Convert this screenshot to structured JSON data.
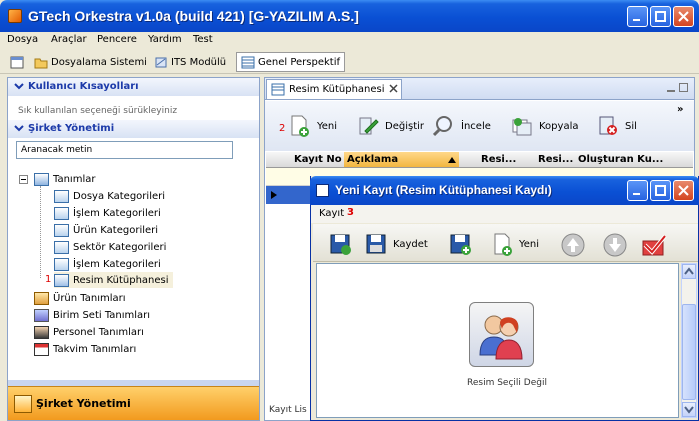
{
  "window": {
    "title": "GTech Orkestra v1.0a (build 421) [G-YAZILIM A.S.]"
  },
  "menu": [
    "Dosya",
    "Araçlar",
    "Pencere",
    "Yardım",
    "Test"
  ],
  "perspectives": [
    {
      "label": "Dosyalama Sistemi",
      "icon": "folder-icon"
    },
    {
      "label": "ITS Modülü",
      "icon": "satellite-icon"
    },
    {
      "label": "Genel Perspektif",
      "icon": "table-icon",
      "active": true
    }
  ],
  "left": {
    "shortcuts_title": "Kullanıcı Kısayolları",
    "shortcuts_hint": "Sık kullanılan seçeneği sürükleyiniz",
    "company_title": "Şirket Yönetimi",
    "search_placeholder": "Aranacak metin",
    "tree_root": "Tanımlar",
    "tree_children": [
      "Dosya Kategorileri",
      "İşlem Kategorileri",
      "Ürün Kategorileri",
      "Sektör Kategorileri",
      "İşlem Kategorileri",
      "Resim Kütüphanesi"
    ],
    "tree_other": [
      "Ürün Tanımları",
      "Birim Seti Tanımları",
      "Personel Tanımları",
      "Takvim Tanımları"
    ],
    "marker_1": "1",
    "footer_label": "Şirket Yönetimi"
  },
  "right": {
    "tab_label": "Resim Kütüphanesi",
    "marker_2": "2",
    "tools": [
      "Yeni",
      "Değiştir",
      "İncele",
      "Kopyala",
      "Sil"
    ],
    "grid_headers": [
      "Kayıt No",
      "Açıklama",
      "Resi...",
      "Resi...",
      "Oluşturan Ku..."
    ],
    "bottom_label": "Kayıt Lis"
  },
  "dialog": {
    "title": "Yeni Kayıt (Resim Kütüphanesi Kaydı)",
    "menu": "Kayıt",
    "marker_3": "3",
    "save_label": "Kaydet",
    "new_label": "Yeni",
    "image_caption": "Resim Seçili Değil"
  }
}
